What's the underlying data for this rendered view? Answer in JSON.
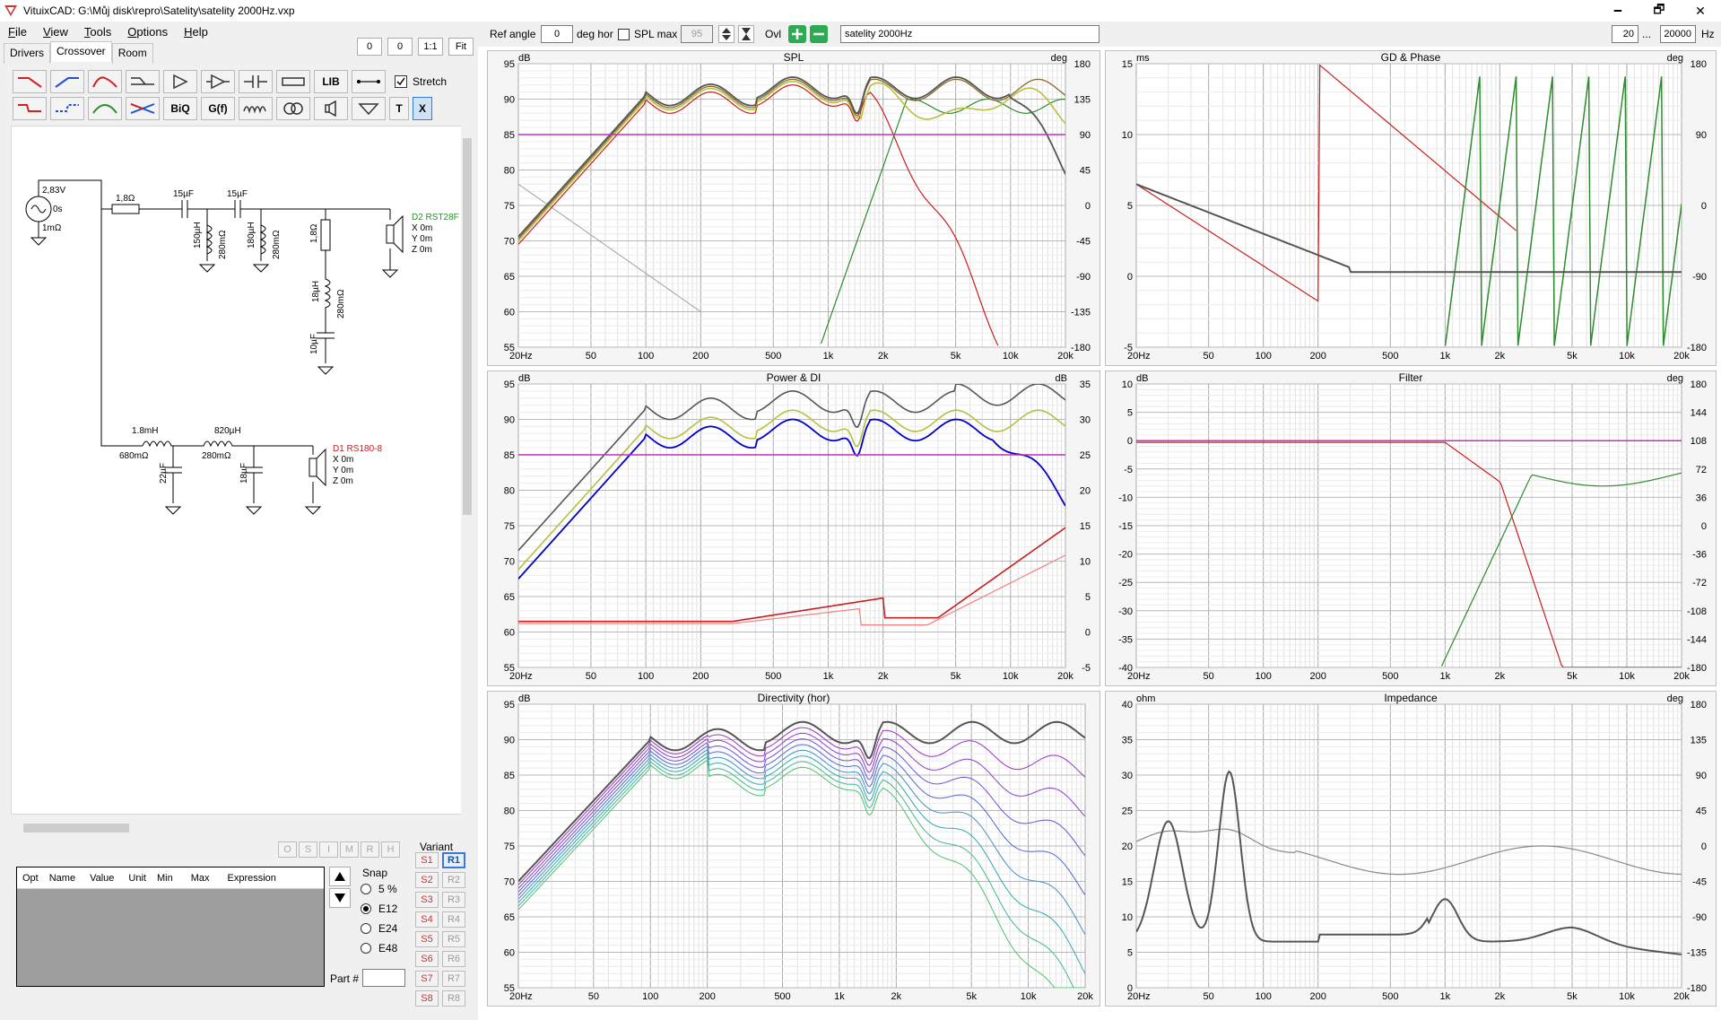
{
  "window": {
    "title": "VituixCAD: G:\\Můj disk\\repro\\Satelity\\satelity 2000Hz.vxp",
    "controls": [
      "🗕",
      "🗗",
      "✕"
    ]
  },
  "menu": [
    "File",
    "View",
    "Tools",
    "Options",
    "Help"
  ],
  "tabs": [
    "Drivers",
    "Crossover",
    "Room"
  ],
  "top_buttons": {
    "v1": "0",
    "v2": "0",
    "scale": "1:1",
    "fit": "Fit"
  },
  "toolbar": {
    "lib": "LIB",
    "stretch": "Stretch",
    "biq": "BiQ",
    "gf": "G(f)",
    "t": "T",
    "x": "X"
  },
  "ctrl": {
    "ref_angle_label": "Ref angle",
    "ref_angle": "0",
    "deg_hor": "deg hor",
    "spl_max": "SPL max",
    "spl_max_val": "95",
    "ovl": "Ovl",
    "preset": "satelity 2000Hz",
    "freq_from": "20",
    "ellipsis": "...",
    "freq_to": "20000",
    "hz": "Hz"
  },
  "schematic": {
    "source_v": "2,83V",
    "source_t": "0s",
    "source_r": "1mΩ",
    "r1": "1,8Ω",
    "c1": "15µF",
    "c2": "15µF",
    "l1": "150µH",
    "l1r": "280mΩ",
    "l2": "180µH",
    "l2r": "280mΩ",
    "r2": "1,8Ω",
    "l3": "18µH",
    "l3r": "280mΩ",
    "c3": "10µF",
    "d2": "D2 RST28F",
    "d2x": "X 0m",
    "d2y": "Y 0m",
    "d2z": "Z 0m",
    "l4": "1.8mH",
    "l4r": "680mΩ",
    "c4": "22µF",
    "l5": "820µH",
    "l5r": "280mΩ",
    "c5": "18µF",
    "d1": "D1 RS180-8",
    "d1x": "X 0m",
    "d1y": "Y 0m",
    "d1z": "Z 0m"
  },
  "opt_buttons": [
    "O",
    "S",
    "I",
    "M",
    "R",
    "H"
  ],
  "opt_table": {
    "columns": [
      "Opt",
      "Name",
      "Value",
      "Unit",
      "Min",
      "Max",
      "Expression"
    ]
  },
  "snap": {
    "label": "Snap",
    "options": [
      "5 %",
      "E12",
      "E24",
      "E48"
    ],
    "selected": "E12"
  },
  "part_label": "Part #",
  "variant": {
    "label": "Variant",
    "s": [
      "S1",
      "S2",
      "S3",
      "S4",
      "S5",
      "S6",
      "S7",
      "S8"
    ],
    "r": [
      "R1",
      "R2",
      "R3",
      "R4",
      "R5",
      "R6",
      "R7",
      "R8"
    ]
  },
  "x_ticks": [
    "20Hz",
    "50",
    "100",
    "200",
    "500",
    "1k",
    "2k",
    "5k",
    "10k",
    "20k"
  ],
  "panels": {
    "spl": {
      "title": "SPL",
      "unit_l": "dB",
      "unit_r": "deg",
      "yl": [
        "95",
        "90",
        "85",
        "80",
        "75",
        "70",
        "65",
        "60",
        "55"
      ],
      "yr": [
        "180",
        "135",
        "90",
        "45",
        "0",
        "-45",
        "-90",
        "-135",
        "-180"
      ]
    },
    "gd": {
      "title": "GD & Phase",
      "unit_l": "ms",
      "unit_r": "deg",
      "yl": [
        "15",
        "10",
        "5",
        "0",
        "-5"
      ],
      "yr": [
        "180",
        "90",
        "0",
        "-90",
        "-180"
      ]
    },
    "pwr": {
      "title": "Power & DI",
      "unit_l": "dB",
      "unit_r": "dB",
      "yl": [
        "95",
        "90",
        "85",
        "80",
        "75",
        "70",
        "65",
        "60",
        "55"
      ],
      "yr": [
        "35",
        "30",
        "25",
        "20",
        "15",
        "10",
        "5",
        "0",
        "-5"
      ]
    },
    "filter": {
      "title": "Filter",
      "unit_l": "dB",
      "unit_r": "deg",
      "yl": [
        "10",
        "5",
        "0",
        "-5",
        "-10",
        "-15",
        "-20",
        "-25",
        "-30",
        "-35",
        "-40"
      ],
      "yr": [
        "180",
        "144",
        "108",
        "72",
        "36",
        "0",
        "-36",
        "-72",
        "-108",
        "-144",
        "-180"
      ]
    },
    "dir": {
      "title": "Directivity (hor)",
      "unit_l": "dB",
      "yl": [
        "95",
        "90",
        "85",
        "80",
        "75",
        "70",
        "65",
        "60",
        "55"
      ]
    },
    "imp": {
      "title": "Impedance",
      "unit_l": "ohm",
      "unit_r": "deg",
      "yl": [
        "40",
        "35",
        "30",
        "25",
        "20",
        "15",
        "10",
        "5",
        "0"
      ],
      "yr": [
        "180",
        "135",
        "90",
        "45",
        "0",
        "-45",
        "-90",
        "-135",
        "-180"
      ]
    }
  },
  "colors": {
    "accent": "#3c78d8",
    "sum": "#555555",
    "woofer": "#c81e1e",
    "tweeter": "#2e8b2e",
    "ref": "#c030c0",
    "di": "#0000c8"
  }
}
